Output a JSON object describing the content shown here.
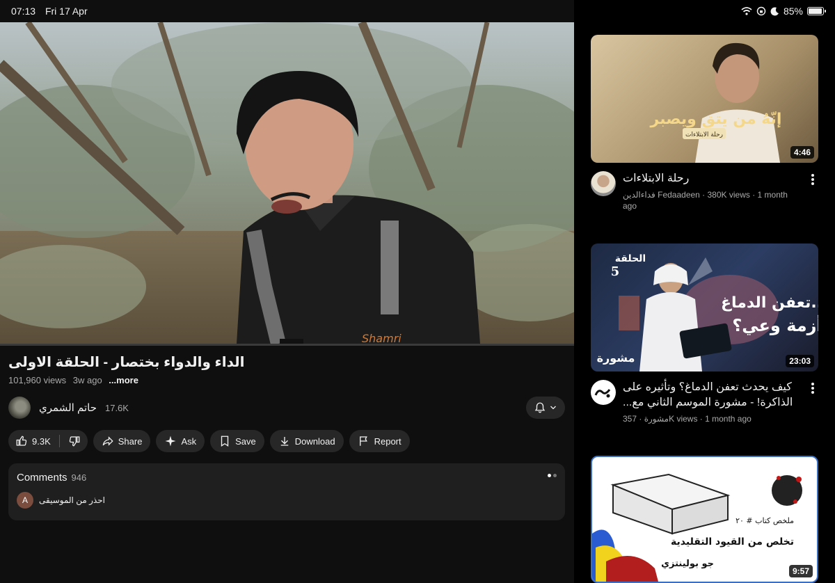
{
  "status_bar": {
    "time": "07:13",
    "date": "Fri 17 Apr",
    "battery_text": "85%",
    "battery_level": 85
  },
  "video": {
    "title": "الداء والدواء بختصار - الحلقة الاولى",
    "views": "101,960 views",
    "age": "3w ago",
    "more_label": "...more",
    "progress_fraction": 0.0
  },
  "channel": {
    "name": "حاتم الشمري",
    "subscribers": "17.6K"
  },
  "actions": {
    "likes": "9.3K",
    "share": "Share",
    "ask": "Ask",
    "save": "Save",
    "download": "Download",
    "report": "Report"
  },
  "comments": {
    "label": "Comments",
    "count": "946",
    "top_author_initial": "A",
    "top_text": "احذر من الموسيقى"
  },
  "recommendations": [
    {
      "title": "رحلة الابتلاءات",
      "meta": "فداءالدين Fedaadeen · 380K views · 1 month ago",
      "duration": "4:46",
      "thumb_text": "إنّهُ من يتقِ ويصبر",
      "thumb_sub": "رحلة الابتلاءات"
    },
    {
      "title": "كيف يحدث تعفن الدماغ؟ وتأثيره على الذاكرة! - مشورة الموسم الثاني مع...",
      "meta": "مشورة · 357K views · 1 month ago",
      "duration": "23:03",
      "thumb_text": "تعفن الدماغ..",
      "thumb_text2": "أزمة وعي؟",
      "thumb_ep": "الحلقة",
      "thumb_ep_num": "5",
      "thumb_logo": "مشورة"
    },
    {
      "duration": "9:57",
      "thumb_label": "ملخص كتاب # ٢٠",
      "thumb_text": "تخلص من القيود التقليدية",
      "thumb_author": "جو بولينتزي"
    }
  ],
  "colors": {
    "background": "#0f0f0f",
    "pill": "#272727",
    "sidebar": "#000000"
  }
}
